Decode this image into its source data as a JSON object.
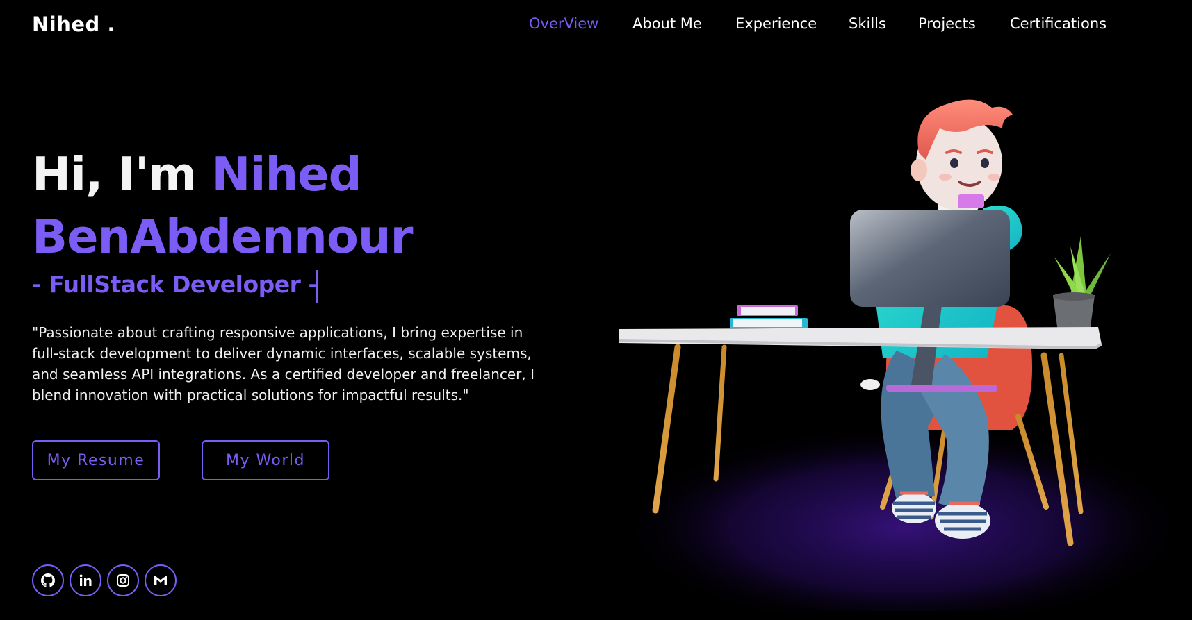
{
  "brand": {
    "logo": "Nihed ."
  },
  "nav": {
    "items": [
      {
        "label": "OverView",
        "active": true
      },
      {
        "label": "About Me",
        "active": false
      },
      {
        "label": "Experience",
        "active": false
      },
      {
        "label": "Skills",
        "active": false
      },
      {
        "label": "Projects",
        "active": false
      },
      {
        "label": "Certifications",
        "active": false
      }
    ]
  },
  "hero": {
    "greeting": "Hi, I'm",
    "first_name": "Nihed",
    "last_name": "BenAbdennour",
    "role": "- FullStack Developer -",
    "description": "\"Passionate about crafting responsive applications, I bring expertise in full-stack development to deliver dynamic interfaces, scalable systems, and seamless API integrations. As a certified developer and freelancer, I blend innovation with practical solutions for impactful results.\""
  },
  "buttons": {
    "resume": "My Resume",
    "world": "My World"
  },
  "social": [
    {
      "icon": "github-icon"
    },
    {
      "icon": "linkedin-icon"
    },
    {
      "icon": "instagram-icon"
    },
    {
      "icon": "gmail-icon"
    }
  ],
  "theme": {
    "background": "#000000",
    "accent": "#7b5cf5",
    "text": "#ffffff"
  }
}
